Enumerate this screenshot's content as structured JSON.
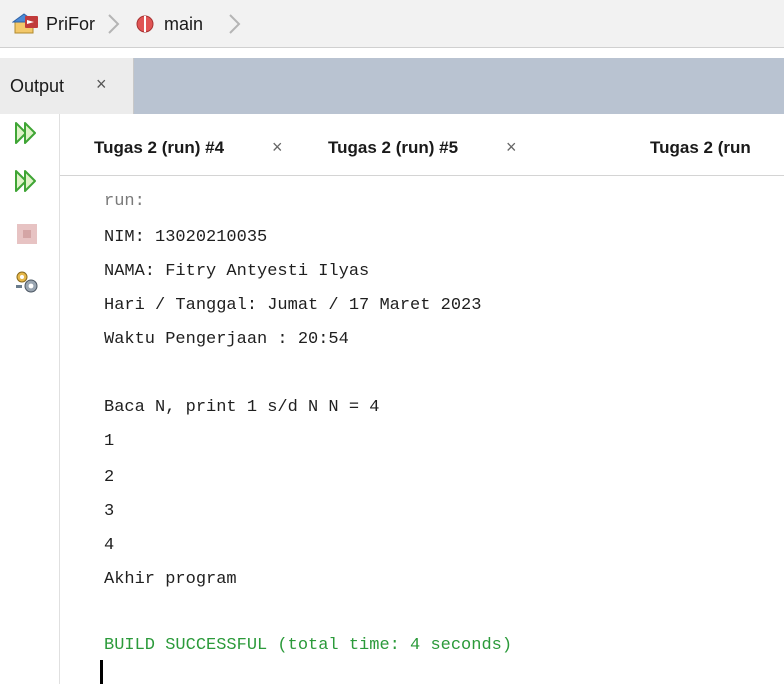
{
  "breadcrumb": {
    "items": [
      {
        "label": "PriFor",
        "icon": "project-icon"
      },
      {
        "label": "main",
        "icon": "method-icon"
      }
    ]
  },
  "output_panel": {
    "tab_label": "Output",
    "close_glyph": "×"
  },
  "run_tabs": [
    {
      "label": "Tugas 2 (run) #4",
      "close_glyph": "×"
    },
    {
      "label": "Tugas 2 (run) #5",
      "close_glyph": "×"
    },
    {
      "label": "Tugas 2 (run"
    }
  ],
  "toolbar": {
    "buttons": [
      "rerun-icon",
      "rerun-with-options-icon",
      "stop-icon",
      "settings-icon"
    ]
  },
  "console": {
    "lines": [
      "run:",
      "NIM: 13020210035",
      "NAMA: Fitry Antyesti Ilyas",
      "Hari / Tanggal: Jumat / 17 Maret 2023",
      "Waktu Pengerjaan : 20:54",
      "",
      "Baca N, print 1 s/d N N = 4",
      "1",
      "2",
      "3",
      "4",
      "Akhir program",
      "",
      "BUILD SUCCESSFUL (total time: 4 seconds)"
    ]
  },
  "colors": {
    "header_bar": "#b9c3d1",
    "success_text": "#2b9a3a",
    "run_arrow": "#3fa535"
  }
}
